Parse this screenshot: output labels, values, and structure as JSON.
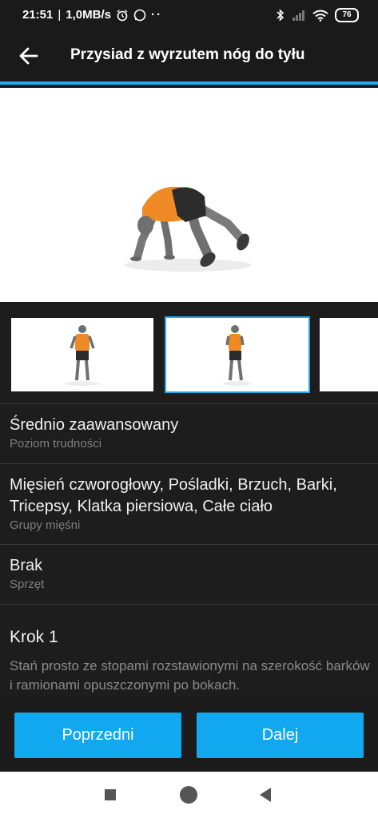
{
  "status": {
    "time": "21:51",
    "speed": "1,0MB/s",
    "battery": "76"
  },
  "toolbar": {
    "title": "Przysiad z wyrzutem nóg do tyłu"
  },
  "info": [
    {
      "value": "Średnio zaawansowany",
      "label": "Poziom trudności"
    },
    {
      "value": "Mięsień czworogłowy, Pośladki, Brzuch, Barki, Tricepsy, Klatka piersiowa, Całe ciało",
      "label": "Grupy mięśni"
    },
    {
      "value": "Brak",
      "label": "Sprzęt"
    }
  ],
  "step": {
    "title": "Krok 1",
    "text": "Stań prosto ze stopami rozstawionymi na szerokość barków i ramionami opuszczonymi po bokach."
  },
  "buttons": {
    "prev": "Poprzedni",
    "next": "Dalej"
  },
  "colors": {
    "accent": "#12a8ef",
    "background": "#1d1d1d",
    "shirt": "#f08a24"
  }
}
